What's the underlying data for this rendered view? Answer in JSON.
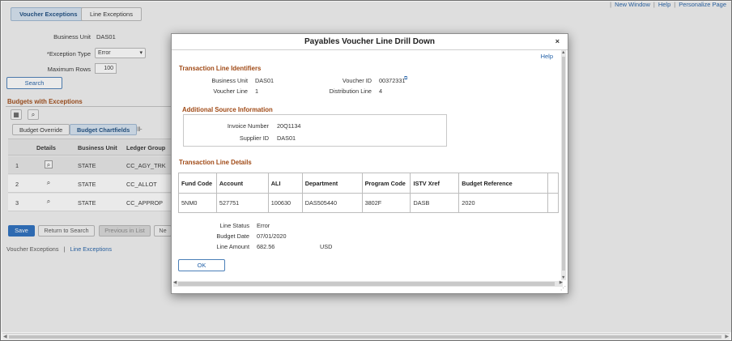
{
  "top_links": {
    "new_window": "New Window",
    "help": "Help",
    "personalize": "Personalize Page"
  },
  "tabs": {
    "voucher_exceptions": "Voucher Exceptions",
    "line_exceptions": "Line Exceptions"
  },
  "criteria": {
    "business_unit_label": "Business Unit",
    "business_unit_value": "DAS01",
    "exception_type_label": "*Exception Type",
    "exception_type_value": "Error",
    "max_rows_label": "Maximum Rows",
    "max_rows_value": "100",
    "search_button": "Search"
  },
  "budgets": {
    "title": "Budgets with Exceptions",
    "subtabs": {
      "budget_override": "Budget Override",
      "budget_chartfields": "Budget Chartfields"
    },
    "columns": {
      "details": "Details",
      "business_unit": "Business Unit",
      "ledger_group": "Ledger Group"
    },
    "rows": [
      {
        "num": "1",
        "business_unit": "STATE",
        "ledger_group": "CC_AGY_TRK"
      },
      {
        "num": "2",
        "business_unit": "STATE",
        "ledger_group": "CC_ALLOT"
      },
      {
        "num": "3",
        "business_unit": "STATE",
        "ledger_group": "CC_APPROP"
      }
    ]
  },
  "actions": {
    "save": "Save",
    "return_to_search": "Return to Search",
    "previous_in_list": "Previous in List",
    "next_in_list": "Ne"
  },
  "footer": {
    "voucher_exceptions": "Voucher Exceptions",
    "separator": "|",
    "line_exceptions": "Line Exceptions"
  },
  "modal": {
    "title": "Payables Voucher Line Drill Down",
    "close": "×",
    "help": "Help",
    "identifiers": {
      "title": "Transaction Line Identifiers",
      "business_unit_label": "Business Unit",
      "business_unit_value": "DAS01",
      "voucher_id_label": "Voucher ID",
      "voucher_id_value": "00372331",
      "voucher_line_label": "Voucher Line",
      "voucher_line_value": "1",
      "distribution_line_label": "Distribution Line",
      "distribution_line_value": "4"
    },
    "additional": {
      "title": "Additional Source Information",
      "invoice_number_label": "Invoice Number",
      "invoice_number_value": "20Q1134",
      "supplier_id_label": "Supplier ID",
      "supplier_id_value": "DAS01"
    },
    "details": {
      "title": "Transaction Line Details",
      "columns": [
        "Fund Code",
        "Account",
        "ALI",
        "Department",
        "Program Code",
        "ISTV Xref",
        "Budget Reference"
      ],
      "row": [
        "5NM0",
        "527751",
        "100630",
        "DAS505440",
        "3802F",
        "DASB",
        "2020"
      ],
      "line_status_label": "Line Status",
      "line_status_value": "Error",
      "budget_date_label": "Budget Date",
      "budget_date_value": "07/01/2020",
      "line_amount_label": "Line Amount",
      "line_amount_value": "682.56",
      "currency": "USD"
    },
    "ok_button": "OK"
  }
}
